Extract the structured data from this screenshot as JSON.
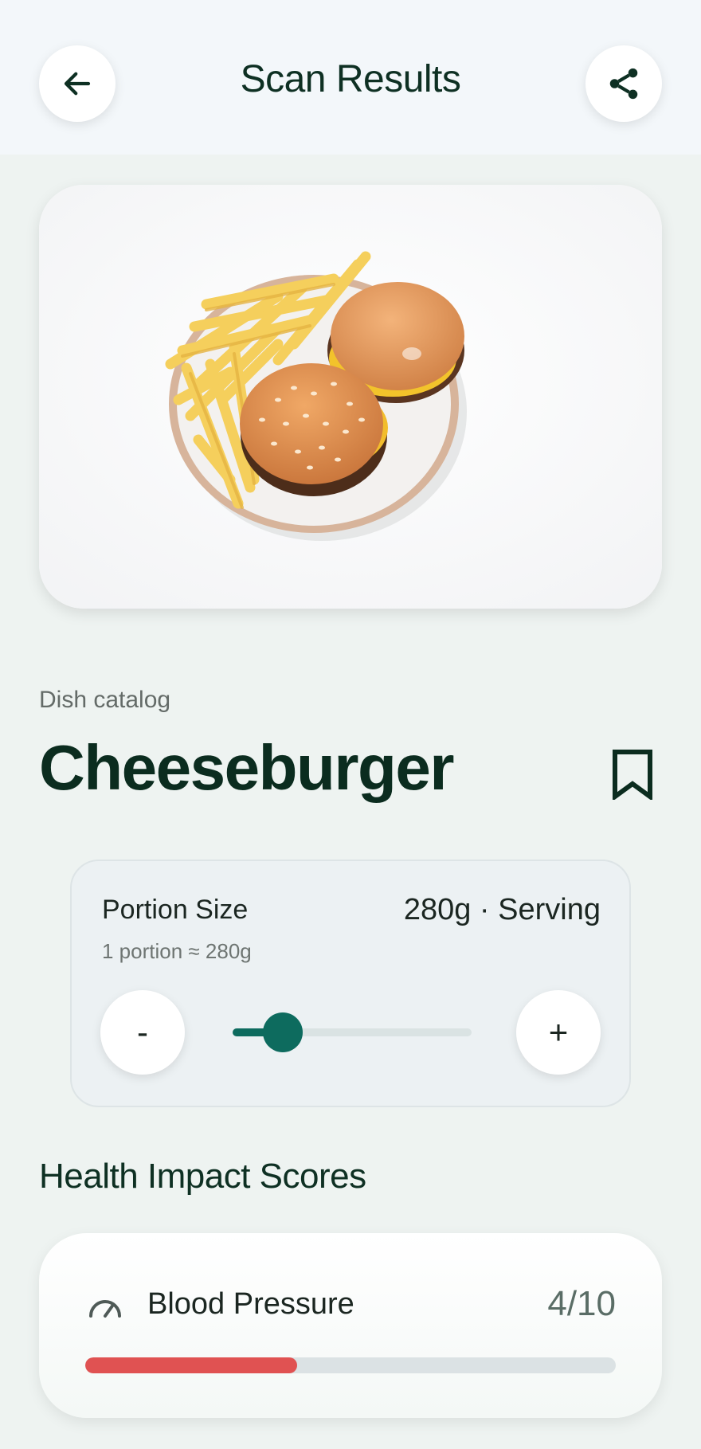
{
  "header": {
    "title": "Scan Results",
    "back_icon": "arrow-left-icon",
    "share_icon": "share-icon"
  },
  "photo": {
    "alt": "Cheeseburger with french fries on a plate"
  },
  "dish": {
    "catalog_label": "Dish catalog",
    "name": "Cheeseburger",
    "bookmark_icon": "bookmark-icon"
  },
  "portion": {
    "label": "Portion Size",
    "value": "280g · Serving",
    "sub": "1 portion ≈ 280g",
    "minus_label": "-",
    "plus_label": "+",
    "slider_level": 0.21
  },
  "health": {
    "section_title": "Health Impact Scores",
    "scores": [
      {
        "name": "Blood Pressure",
        "icon": "gauge-icon",
        "value": "4/10",
        "level": 0.4,
        "bar_color": "#e05252"
      }
    ]
  },
  "colors": {
    "accent": "#0d6b5e",
    "title": "#0e3023",
    "warning": "#e05252"
  }
}
